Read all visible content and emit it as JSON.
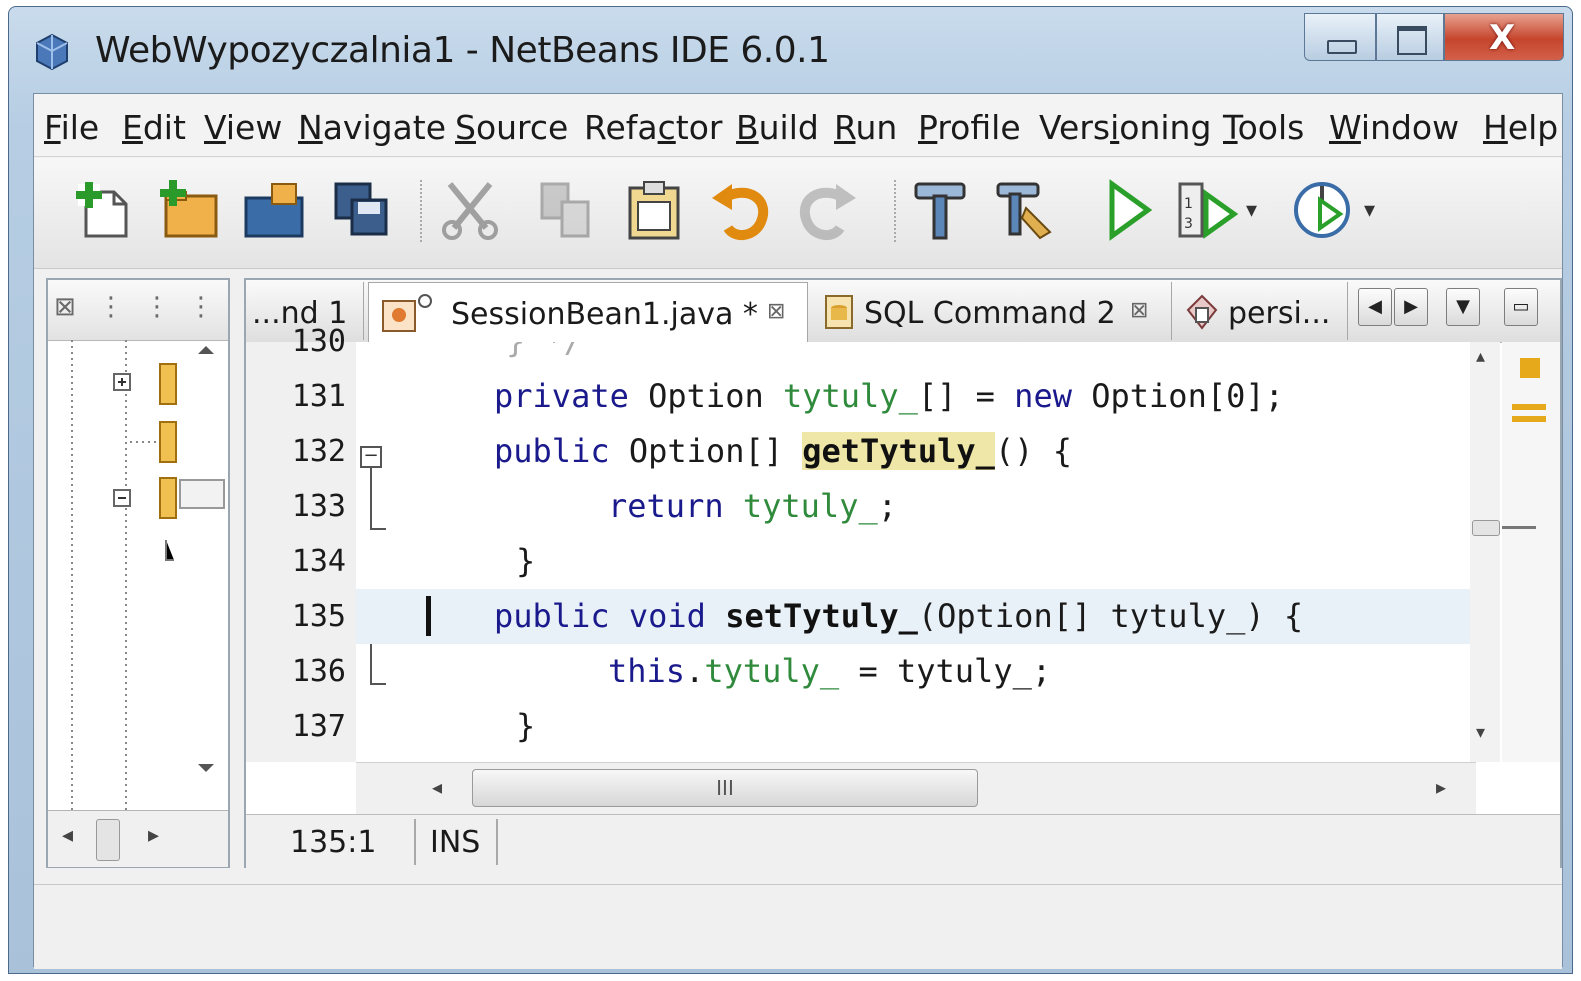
{
  "window": {
    "title": "WebWypozyczalnia1 - NetBeans IDE 6.0.1"
  },
  "menu": [
    {
      "pre": "",
      "u": "F",
      "post": "ile"
    },
    {
      "pre": "",
      "u": "E",
      "post": "dit"
    },
    {
      "pre": "",
      "u": "V",
      "post": "iew"
    },
    {
      "pre": "",
      "u": "N",
      "post": "avigate"
    },
    {
      "pre": "",
      "u": "S",
      "post": "ource"
    },
    {
      "pre": "Refa",
      "u": "c",
      "post": "tor"
    },
    {
      "pre": "",
      "u": "B",
      "post": "uild"
    },
    {
      "pre": "",
      "u": "R",
      "post": "un"
    },
    {
      "pre": "",
      "u": "P",
      "post": "rofile"
    },
    {
      "pre": "Vers",
      "u": "i",
      "post": "oning"
    },
    {
      "pre": "",
      "u": "T",
      "post": "ools"
    },
    {
      "pre": "",
      "u": "W",
      "post": "indow"
    },
    {
      "pre": "",
      "u": "H",
      "post": "elp"
    }
  ],
  "toolbar": {
    "icons": [
      "new-file-icon",
      "new-project-icon",
      "open-project-icon",
      "save-all-icon",
      "cut-icon",
      "copy-icon",
      "paste-icon",
      "undo-icon",
      "redo-icon",
      "build-icon",
      "clean-build-icon",
      "run-icon",
      "debug-icon",
      "profile-icon"
    ]
  },
  "tabs": [
    {
      "label": "...nd 1",
      "close": ""
    },
    {
      "label": "SessionBean1.java *",
      "close": "⊠"
    },
    {
      "label": "SQL Command 2",
      "close": "⊠"
    },
    {
      "label": "persi...",
      "close": ""
    }
  ],
  "code": {
    "lines": [
      {
        "num": "130"
      },
      {
        "num": "131"
      },
      {
        "num": "132"
      },
      {
        "num": "133"
      },
      {
        "num": "134"
      },
      {
        "num": "135"
      },
      {
        "num": "136"
      },
      {
        "num": "137"
      }
    ],
    "t131": {
      "a": "private",
      "b": " Option ",
      "c": "tytuly_",
      "d": "[] = ",
      "e": "new",
      "f": " Option[0];"
    },
    "t132": {
      "a": "public",
      "b": " Option[] ",
      "c": "getTytuly_",
      "d": "() {"
    },
    "t133": {
      "a": "return",
      "b": " ",
      "c": "tytuly_",
      "d": ";"
    },
    "t134": {
      "a": "}"
    },
    "t135": {
      "a": "public",
      "b": " ",
      "c": "void",
      "d": " ",
      "e": "setTytuly_",
      "f": "(Option[] tytuly_) {"
    },
    "t136": {
      "a": "this",
      "b": ".",
      "c": "tytuly_",
      "d": " = tytuly_;"
    },
    "t137": {
      "a": "}"
    }
  },
  "status": {
    "position": "135:1",
    "mode": "INS"
  },
  "scroll": {
    "thumb": "III"
  }
}
